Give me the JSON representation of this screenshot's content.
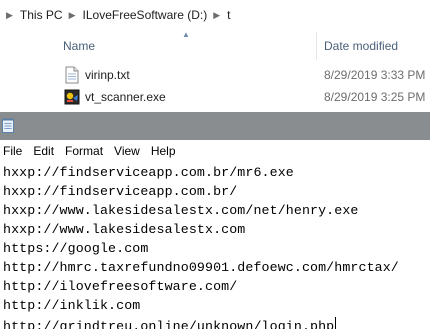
{
  "explorer": {
    "breadcrumb": [
      "This PC",
      "ILoveFreeSoftware (D:)",
      "t"
    ],
    "columns": {
      "name": "Name",
      "date_modified": "Date modified"
    },
    "files": [
      {
        "name": "virinp.txt",
        "date": "8/29/2019 3:33 PM",
        "icon": "text-file-icon"
      },
      {
        "name": "vt_scanner.exe",
        "date": "8/29/2019 3:25 PM",
        "icon": "exe-file-icon"
      }
    ]
  },
  "notepad": {
    "menu": [
      "File",
      "Edit",
      "Format",
      "View",
      "Help"
    ],
    "lines": [
      "hxxp://findserviceapp.com.br/mr6.exe",
      "hxxp://findserviceapp.com.br/",
      "hxxp://www.lakesidesalestx.com/net/henry.exe",
      "hxxp://www.lakesidesalestx.com",
      "https://google.com",
      "http://hmrc.taxrefundno09901.defoewc.com/hmrctax/",
      "http://ilovefreesoftware.com/",
      "http://inklik.com",
      "http://grindtreu.online/unknown/login.php"
    ]
  },
  "colors": {
    "titlebar": "#8a8d90",
    "header_text": "#4c607a",
    "date_text": "#6d6d6d"
  }
}
